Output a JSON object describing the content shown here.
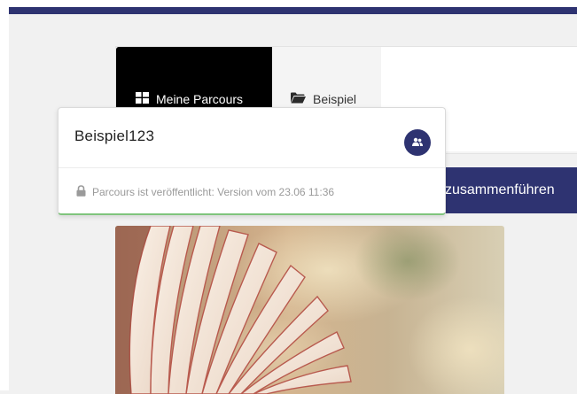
{
  "nav": {
    "tabs": [
      {
        "label": "Meine Parcours",
        "icon": "grid-icon",
        "active": true
      },
      {
        "label": "Beispiel",
        "icon": "folder-icon",
        "active": false
      }
    ]
  },
  "toolbar": {
    "merge_label": "zusammenführen"
  },
  "card": {
    "title": "Beispiel123",
    "share_icon": "users-icon",
    "status_icon": "lock-icon",
    "status_text": "Parcours ist veröffentlicht: Version vom 23.06 11:36"
  },
  "colors": {
    "brand": "#2e3371",
    "published_accent": "#7fc47c",
    "tab_active_bg": "#000000"
  }
}
